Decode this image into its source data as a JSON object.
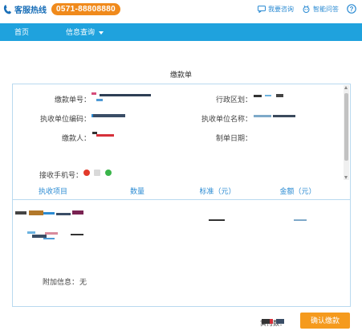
{
  "topbar": {
    "hotline_label": "客服热线",
    "hotline_number": "0571-88808880",
    "links": [
      {
        "label": "我要咨询",
        "icon": "chat-icon"
      },
      {
        "label": "智能问答",
        "icon": "robot-icon"
      }
    ],
    "help_icon": "help-icon"
  },
  "nav": {
    "home": "首页",
    "info_query": "信息查询"
  },
  "page_title": "缴款单",
  "form": {
    "payment_no_label": "缴款单号：",
    "region_label": "行政区划：",
    "collector_code_label": "执收单位编码：",
    "collector_name_label": "执收单位名称：",
    "payer_label": "缴款人：",
    "issue_date_label": "制单日期：",
    "phone_label": "接收手机号："
  },
  "table": {
    "headers": [
      "执收项目",
      "数量",
      "标准（元）",
      "金额（元）"
    ]
  },
  "extra": {
    "label": "附加信息：",
    "value": "无"
  },
  "footer": {
    "paid_label": "实付数：",
    "confirm_label": "确认缴款"
  },
  "colors": {
    "nav_bg": "#1fa2dd",
    "accent_orange": "#f59a1d",
    "hotline_orange": "#f08a1c",
    "link_blue": "#2b8bd3",
    "panel_border": "#b9d9ef"
  }
}
